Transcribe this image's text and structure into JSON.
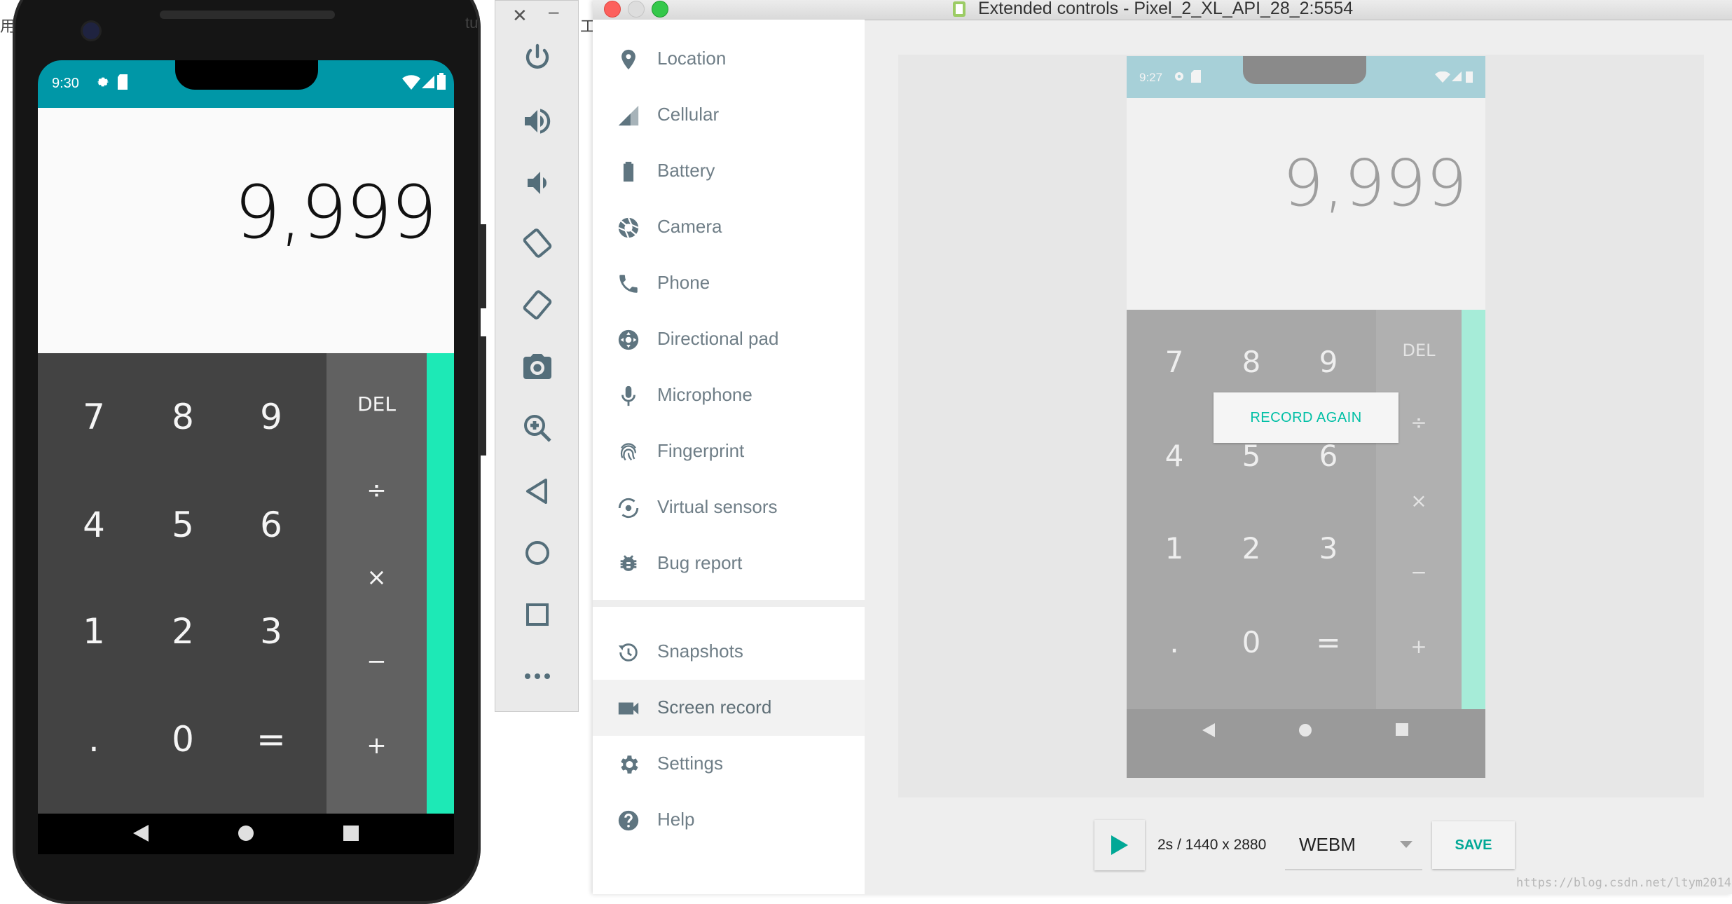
{
  "phone": {
    "status_time": "9:30",
    "display_value": "9,999",
    "keys": [
      "7",
      "8",
      "9",
      "4",
      "5",
      "6",
      "1",
      "2",
      "3",
      ".",
      "0",
      "="
    ],
    "ops": [
      "DEL",
      "÷",
      "×",
      "−",
      "+"
    ]
  },
  "background_text": {
    "left_char": "用",
    "mid_char_1": "tu",
    "mid_char_2": "工"
  },
  "window": {
    "title": "Extended controls - Pixel_2_XL_API_28_2:5554"
  },
  "sidebar": {
    "items": [
      {
        "label": "Location",
        "icon": "location-icon"
      },
      {
        "label": "Cellular",
        "icon": "cellular-icon"
      },
      {
        "label": "Battery",
        "icon": "battery-icon"
      },
      {
        "label": "Camera",
        "icon": "camera-icon"
      },
      {
        "label": "Phone",
        "icon": "phone-icon"
      },
      {
        "label": "Directional pad",
        "icon": "dpad-icon"
      },
      {
        "label": "Microphone",
        "icon": "microphone-icon"
      },
      {
        "label": "Fingerprint",
        "icon": "fingerprint-icon"
      },
      {
        "label": "Virtual sensors",
        "icon": "sensors-icon"
      },
      {
        "label": "Bug report",
        "icon": "bug-icon"
      },
      {
        "label": "Snapshots",
        "icon": "history-icon"
      },
      {
        "label": "Screen record",
        "icon": "videocam-icon",
        "active": true
      },
      {
        "label": "Settings",
        "icon": "gear-icon"
      },
      {
        "label": "Help",
        "icon": "help-icon"
      }
    ]
  },
  "preview": {
    "status_time": "9:27",
    "display_value": "9,999",
    "keys": [
      "7",
      "8",
      "9",
      "4",
      "5",
      "6",
      "1",
      "2",
      "3",
      ".",
      "0",
      "="
    ],
    "ops": [
      "DEL",
      "÷",
      "×",
      "−",
      "+"
    ],
    "record_again_label": "RECORD AGAIN"
  },
  "recording": {
    "info": "2s / 1440 x 2880",
    "format": "WEBM",
    "save_label": "SAVE"
  },
  "watermark": "https://blog.csdn.net/ltym2014",
  "colors": {
    "status_bar": "#0097a7",
    "accent": "#1de9b6",
    "teal_text": "#00bfa5"
  }
}
